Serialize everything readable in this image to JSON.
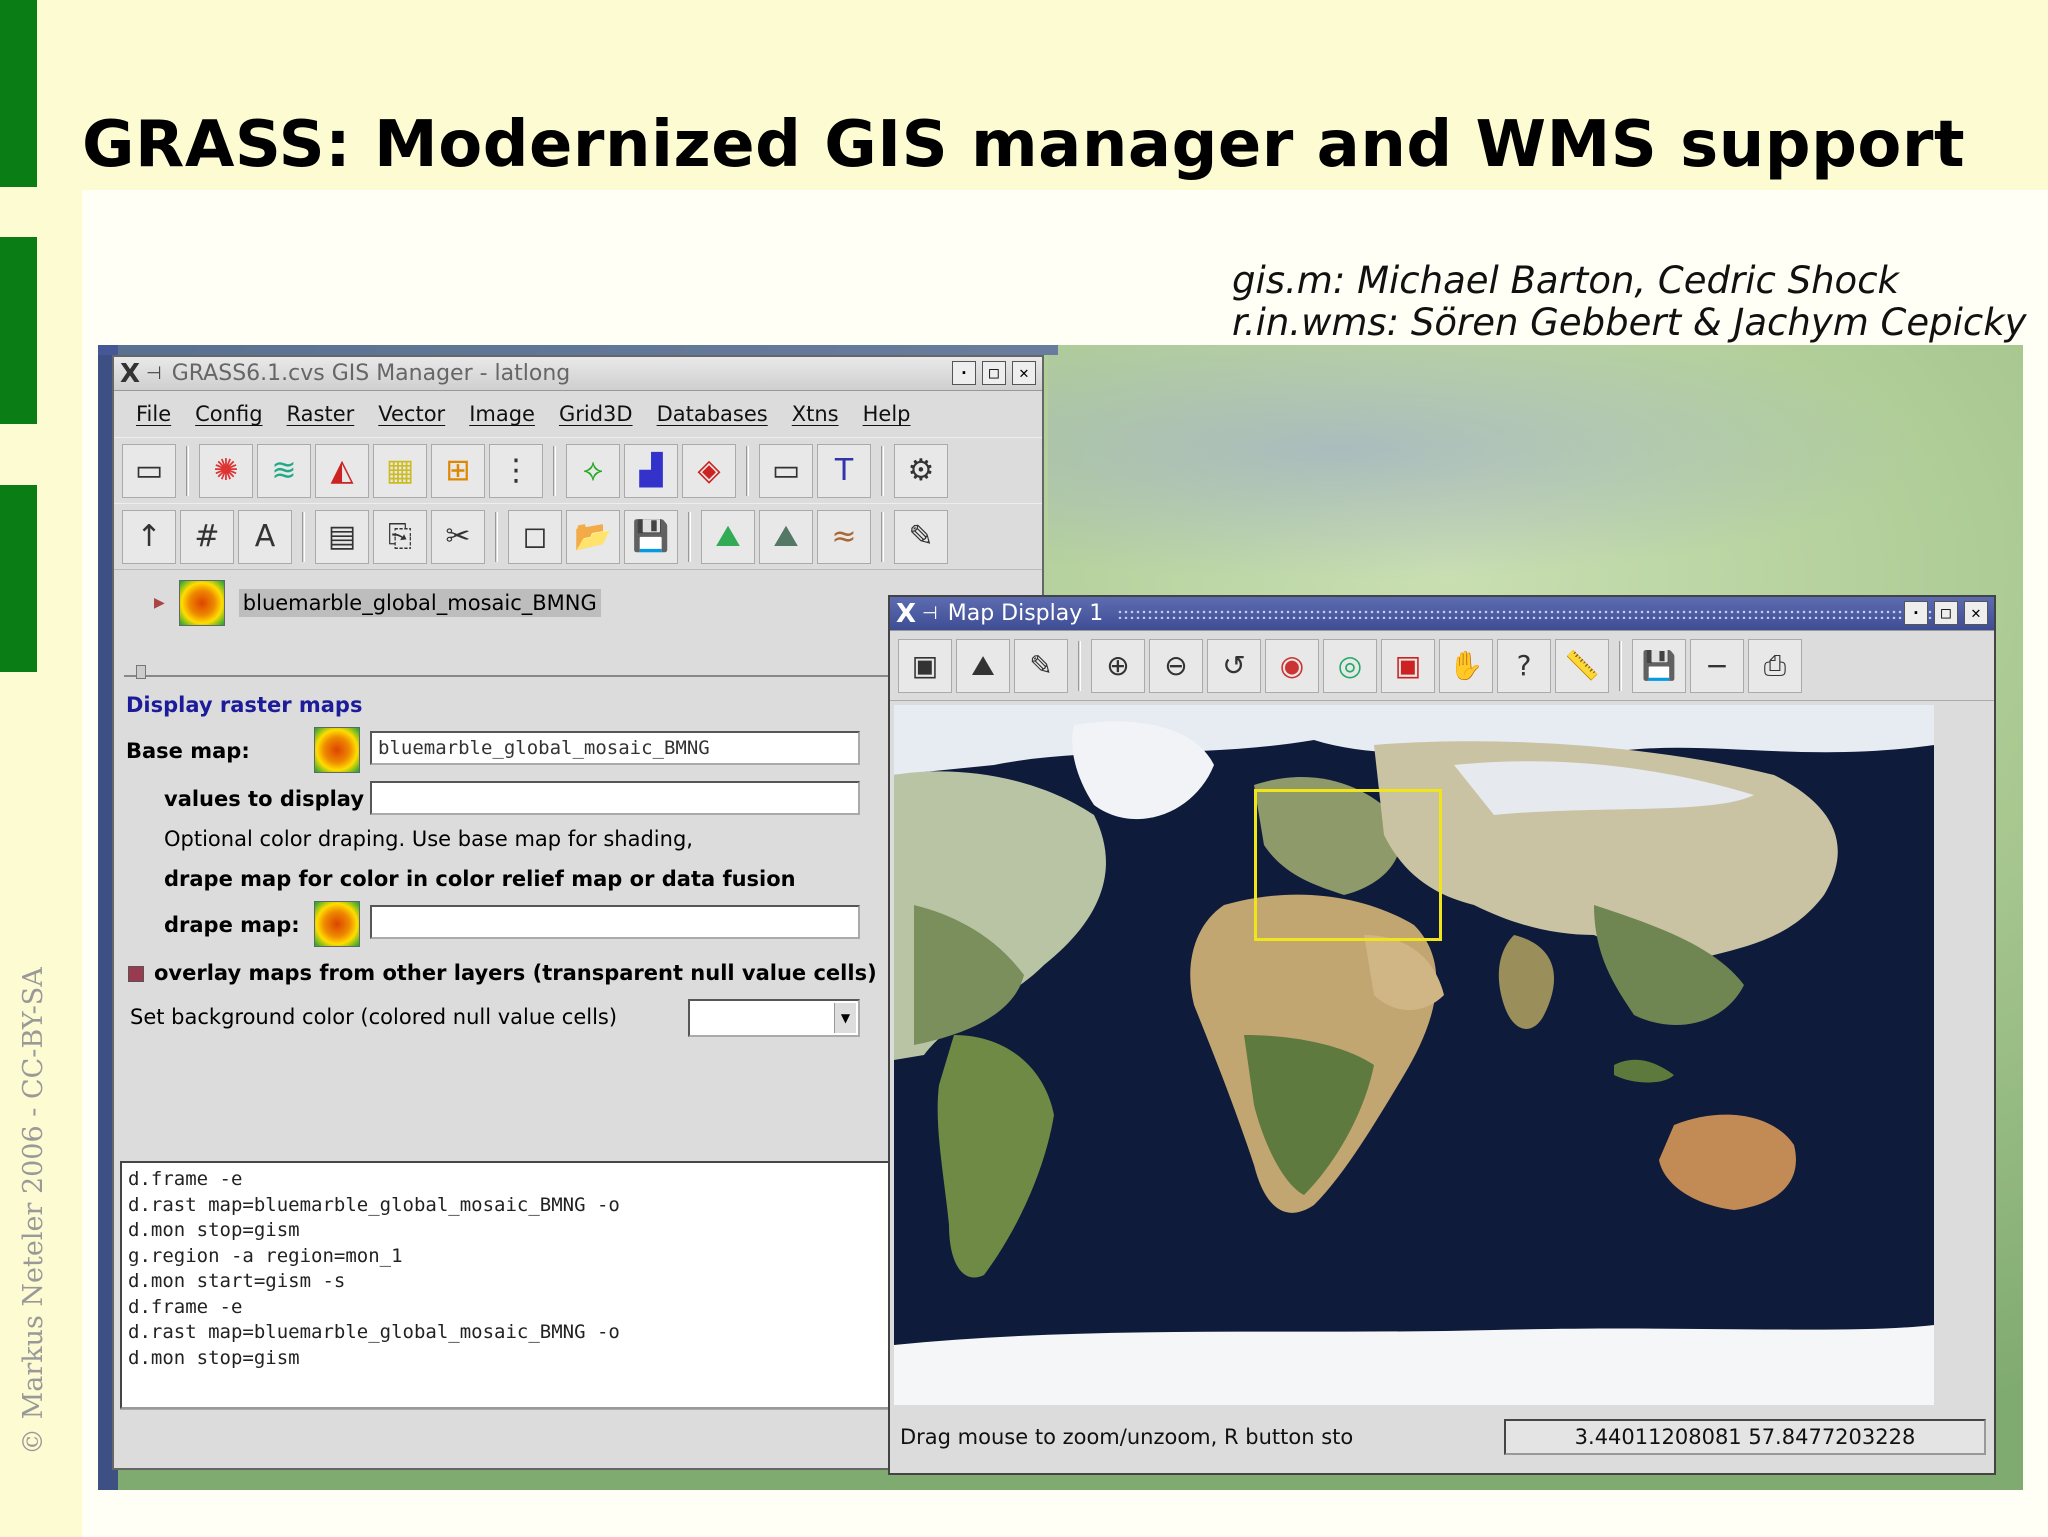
{
  "slide": {
    "title": "GRASS: Modernized GIS manager and WMS support",
    "credit_line1": "gis.m: Michael Barton, Cedric Shock",
    "credit_line2": "r.in.wms: Sören Gebbert & Jachym Cepicky",
    "copyright": "© Markus Neteler 2006 - CC-BY-SA"
  },
  "gis_manager": {
    "title": "GRASS6.1.cvs GIS Manager - latlong",
    "menu": [
      "File",
      "Config",
      "Raster",
      "Vector",
      "Image",
      "Grid3D",
      "Databases",
      "Xtns",
      "Help"
    ],
    "toolbar1_icons": [
      "new-display-icon",
      "raster-icon",
      "rgb-icon",
      "histogram-icon",
      "legend-icon",
      "frame-icon",
      "cell-values-icon",
      "vector-icon",
      "chart-icon",
      "thematic-icon",
      "label-icon",
      "text-icon",
      "command-icon"
    ],
    "toolbar2_icons": [
      "north-arrow-icon",
      "grid-icon",
      "labels-icon",
      "new-group-icon",
      "copy-icon",
      "cut-icon",
      "new-workspace-icon",
      "open-icon",
      "save-icon",
      "nviz-icon",
      "fly-icon",
      "profile-icon",
      "digitize-icon"
    ],
    "layer_name": "bluemarble_global_mosaic_BMNG",
    "props": {
      "heading": "Display raster maps",
      "base_map_label": "Base map:",
      "base_map_value": "bluemarble_global_mosaic_BMNG",
      "values_label": "values to display",
      "values_value": "",
      "drape_note_line1": "Optional color draping. Use base map for shading,",
      "drape_note_line2": "drape map for color in color relief map or data fusion",
      "drape_label": "drape map:",
      "drape_value": "",
      "overlay_label": "overlay maps from other layers (transparent null value cells)",
      "bg_label": "Set background color (colored null value cells)"
    },
    "output_lines": [
      "d.frame -e",
      "d.rast map=bluemarble_global_mosaic_BMNG -o",
      "d.mon stop=gism",
      "g.region -a region=mon_1",
      "d.mon start=gism -s",
      "d.frame -e",
      "d.rast map=bluemarble_global_mosaic_BMNG -o",
      "d.mon stop=gism"
    ]
  },
  "map_display": {
    "title": "Map Display 1",
    "toolbar_icons": [
      "display-icon",
      "render-icon",
      "erase-icon",
      "zoom-in-icon",
      "zoom-out-icon",
      "zoom-back-icon",
      "zoom-current-icon",
      "zoom-region-icon",
      "zoom-default-icon",
      "pan-icon",
      "query-icon",
      "measure-icon",
      "save-icon",
      "minus-icon",
      "print-icon"
    ],
    "status_message": "Drag mouse to zoom/unzoom, R button sto",
    "coordinates": "3.44011208081 57.8477203228",
    "colors": {
      "ocean": "#0f1b3a",
      "zoom_box": "#f0e51b"
    }
  }
}
